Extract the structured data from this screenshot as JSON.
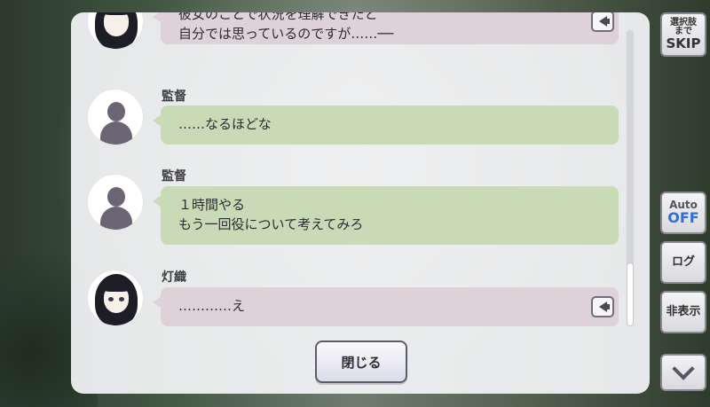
{
  "side_controls": {
    "skip_line1": "選択肢",
    "skip_line2": "まで",
    "skip_line3": "SKIP",
    "auto_label": "Auto",
    "auto_state": "OFF",
    "log_label": "ログ",
    "hide_label": "非表示"
  },
  "log": {
    "entries": [
      {
        "speaker": "",
        "lines": [
          "彼女のことで状況を理解できたと",
          "自分では思っているのですが……──"
        ]
      },
      {
        "speaker": "監督",
        "lines": [
          "……なるほどな"
        ]
      },
      {
        "speaker": "監督",
        "lines": [
          "１時間やる",
          "もう一回役について考えてみろ"
        ]
      },
      {
        "speaker": "灯織",
        "lines": [
          "…………え"
        ]
      }
    ],
    "close_label": "閉じる"
  },
  "colors": {
    "player_bubble": "#c9dbb6",
    "character_bubble": "#dfd1d8",
    "auto_off": "#2f6fd6"
  }
}
